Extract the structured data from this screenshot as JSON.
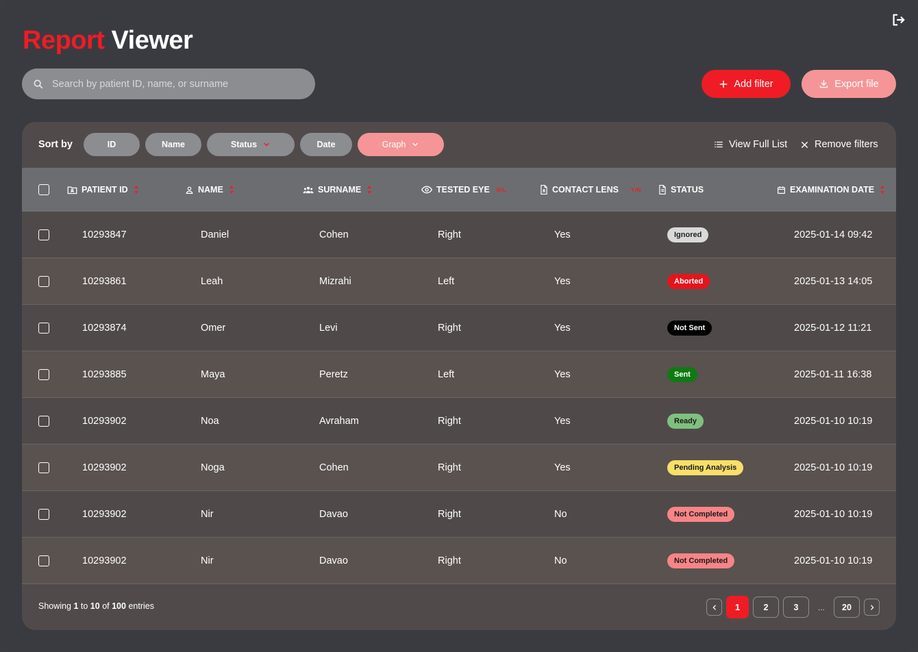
{
  "app": {
    "title_part1": "Report",
    "title_part2": "Viewer"
  },
  "search": {
    "placeholder": "Search by patient ID, name, or surname",
    "value": ""
  },
  "actions": {
    "add_filter": "Add filter",
    "export_file": "Export file"
  },
  "sortbar": {
    "label": "Sort by",
    "chips": [
      {
        "label": "ID"
      },
      {
        "label": "Name"
      },
      {
        "label": "Status"
      },
      {
        "label": "Date"
      },
      {
        "label": "Graph"
      }
    ],
    "view_full_list": "View Full List",
    "remove_filters": "Remove filters"
  },
  "table": {
    "headers": {
      "patient_id": "PATIENT ID",
      "name": "NAME",
      "surname": "SURNAME",
      "tested_eye": "TESTED EYE",
      "tested_eye_hint": "R/L",
      "contact_lens": "CONTACT LENS",
      "contact_lens_hint": "Y/N",
      "status": "STATUS",
      "examination_date": "EXAMINATION DATE"
    },
    "rows": [
      {
        "id": "10293847",
        "name": "Daniel",
        "surname": "Cohen",
        "eye": "Right",
        "lens": "Yes",
        "status": "Ignored",
        "date": "2025-01-14 09:42"
      },
      {
        "id": "10293861",
        "name": "Leah",
        "surname": "Mizrahi",
        "eye": "Left",
        "lens": "Yes",
        "status": "Aborted",
        "date": "2025-01-13 14:05"
      },
      {
        "id": "10293874",
        "name": "Omer",
        "surname": "Levi",
        "eye": "Right",
        "lens": "Yes",
        "status": "Not Sent",
        "date": "2025-01-12 11:21"
      },
      {
        "id": "10293885",
        "name": "Maya",
        "surname": "Peretz",
        "eye": "Left",
        "lens": "Yes",
        "status": "Sent",
        "date": "2025-01-11 16:38"
      },
      {
        "id": "10293902",
        "name": "Noa",
        "surname": "Avraham",
        "eye": "Right",
        "lens": "Yes",
        "status": "Ready",
        "date": "2025-01-10 10:19"
      },
      {
        "id": "10293902",
        "name": "Noga",
        "surname": "Cohen",
        "eye": "Right",
        "lens": "Yes",
        "status": "Pending Analysis",
        "date": "2025-01-10 10:19"
      },
      {
        "id": "10293902",
        "name": "Nir",
        "surname": "Davao",
        "eye": "Right",
        "lens": "No",
        "status": "Not Completed",
        "date": "2025-01-10 10:19"
      },
      {
        "id": "10293902",
        "name": "Nir",
        "surname": "Davao",
        "eye": "Right",
        "lens": "No",
        "status": "Not Completed",
        "date": "2025-01-10 10:19"
      }
    ]
  },
  "status_colors": {
    "Ignored": {
      "bg": "#d9d9d9",
      "fg": "#222222"
    },
    "Aborted": {
      "bg": "#e5141b",
      "fg": "#ffffff"
    },
    "Not Sent": {
      "bg": "#000000",
      "fg": "#ffffff"
    },
    "Sent": {
      "bg": "#0f7a12",
      "fg": "#ffffff"
    },
    "Ready": {
      "bg": "#7fc07f",
      "fg": "#1a1a1a"
    },
    "Pending Analysis": {
      "bg": "#f8df6a",
      "fg": "#1a1a1a"
    },
    "Not Completed": {
      "bg": "#f78487",
      "fg": "#1a1a1a"
    }
  },
  "footer": {
    "showing_prefix": "Showing",
    "from": "1",
    "to_word": "to",
    "to": "10",
    "of_word": "of",
    "total": "100",
    "entries_word": "entries"
  },
  "pagination": {
    "pages": [
      "1",
      "2",
      "3"
    ],
    "ellipsis": "...",
    "last": "20",
    "active": "1"
  },
  "colors": {
    "accent": "#ef1c25",
    "accent_soft": "#f59597",
    "background": "#3a3b40",
    "panel": "#504b4a"
  }
}
